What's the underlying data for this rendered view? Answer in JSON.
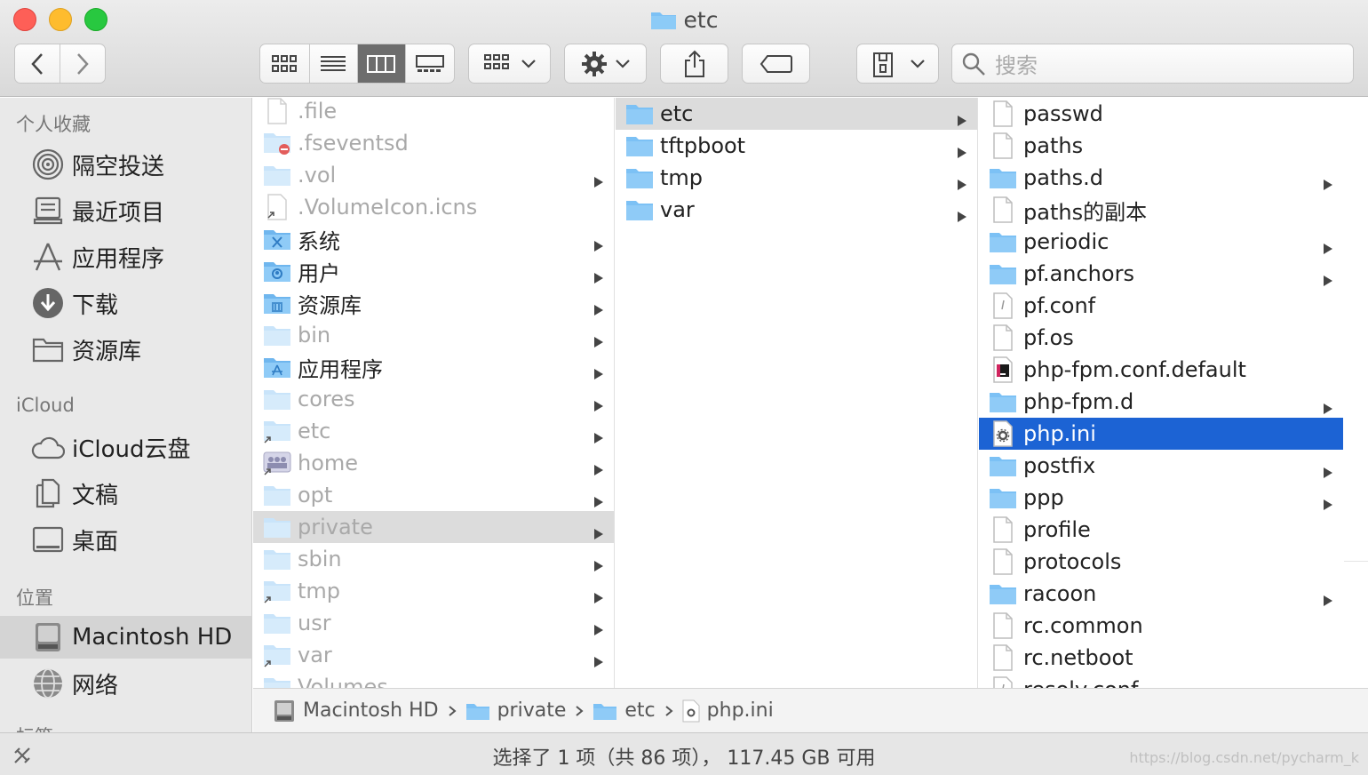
{
  "window": {
    "title": "etc"
  },
  "toolbar": {
    "search_placeholder": "搜索"
  },
  "sidebar": {
    "favorites_header": "个人收藏",
    "favorites": [
      {
        "label": "隔空投送",
        "icon": "airdrop-icon"
      },
      {
        "label": "最近项目",
        "icon": "recents-icon"
      },
      {
        "label": "应用程序",
        "icon": "applications-icon"
      },
      {
        "label": "下载",
        "icon": "downloads-icon"
      },
      {
        "label": "资源库",
        "icon": "folder-icon"
      }
    ],
    "icloud_header": "iCloud",
    "icloud": [
      {
        "label": "iCloud云盘",
        "icon": "cloud-icon"
      },
      {
        "label": "文稿",
        "icon": "documents-icon"
      },
      {
        "label": "桌面",
        "icon": "desktop-icon"
      }
    ],
    "locations_header": "位置",
    "locations": [
      {
        "label": "Macintosh HD",
        "icon": "hard-drive-icon"
      },
      {
        "label": "网络",
        "icon": "network-icon"
      }
    ],
    "tags_header": "标签"
  },
  "columns": {
    "col1": [
      {
        "name": ".file",
        "kind": "file",
        "dim": true,
        "chevron": false
      },
      {
        "name": ".fseventsd",
        "kind": "folder-restricted",
        "dim": true,
        "chevron": false
      },
      {
        "name": ".vol",
        "kind": "folder",
        "dim": true,
        "chevron": true
      },
      {
        "name": ".VolumeIcon.icns",
        "kind": "alias-file",
        "dim": true,
        "chevron": false
      },
      {
        "name": "系统",
        "kind": "folder-system",
        "dim": false,
        "chevron": true
      },
      {
        "name": "用户",
        "kind": "folder-users",
        "dim": false,
        "chevron": true
      },
      {
        "name": "资源库",
        "kind": "folder-library",
        "dim": false,
        "chevron": true
      },
      {
        "name": "bin",
        "kind": "folder",
        "dim": true,
        "chevron": true
      },
      {
        "name": "应用程序",
        "kind": "folder-apps",
        "dim": false,
        "chevron": true
      },
      {
        "name": "cores",
        "kind": "folder",
        "dim": true,
        "chevron": true
      },
      {
        "name": "etc",
        "kind": "alias-folder",
        "dim": true,
        "chevron": true
      },
      {
        "name": "home",
        "kind": "network-folder",
        "dim": true,
        "chevron": true
      },
      {
        "name": "opt",
        "kind": "folder",
        "dim": true,
        "chevron": true
      },
      {
        "name": "private",
        "kind": "folder",
        "dim": true,
        "chevron": true,
        "highlight": true
      },
      {
        "name": "sbin",
        "kind": "folder",
        "dim": true,
        "chevron": true
      },
      {
        "name": "tmp",
        "kind": "alias-folder",
        "dim": true,
        "chevron": true
      },
      {
        "name": "usr",
        "kind": "folder",
        "dim": true,
        "chevron": true
      },
      {
        "name": "var",
        "kind": "alias-folder",
        "dim": true,
        "chevron": true
      },
      {
        "name": "Volumes",
        "kind": "folder",
        "dim": true,
        "chevron": true
      }
    ],
    "col2": [
      {
        "name": "etc",
        "kind": "folder",
        "chevron": true,
        "highlight": true
      },
      {
        "name": "tftpboot",
        "kind": "folder",
        "chevron": true
      },
      {
        "name": "tmp",
        "kind": "folder",
        "chevron": true
      },
      {
        "name": "var",
        "kind": "folder",
        "chevron": true
      }
    ],
    "col3": [
      {
        "name": "passwd",
        "kind": "file",
        "chevron": false
      },
      {
        "name": "paths",
        "kind": "file",
        "chevron": false
      },
      {
        "name": "paths.d",
        "kind": "folder",
        "chevron": true
      },
      {
        "name": "paths的副本",
        "kind": "file",
        "chevron": false
      },
      {
        "name": "periodic",
        "kind": "folder",
        "chevron": true
      },
      {
        "name": "pf.anchors",
        "kind": "folder",
        "chevron": true
      },
      {
        "name": "pf.conf",
        "kind": "conf-file",
        "chevron": false
      },
      {
        "name": "pf.os",
        "kind": "file",
        "chevron": false
      },
      {
        "name": "php-fpm.conf.default",
        "kind": "ide-file",
        "chevron": false
      },
      {
        "name": "php-fpm.d",
        "kind": "folder",
        "chevron": true
      },
      {
        "name": "php.ini",
        "kind": "settings-file",
        "chevron": false,
        "selected": true
      },
      {
        "name": "postfix",
        "kind": "folder",
        "chevron": true
      },
      {
        "name": "ppp",
        "kind": "folder",
        "chevron": true
      },
      {
        "name": "profile",
        "kind": "file",
        "chevron": false
      },
      {
        "name": "protocols",
        "kind": "file",
        "chevron": false
      },
      {
        "name": "racoon",
        "kind": "folder",
        "chevron": true
      },
      {
        "name": "rc.common",
        "kind": "file",
        "chevron": false
      },
      {
        "name": "rc.netboot",
        "kind": "file",
        "chevron": false
      },
      {
        "name": "resolv.conf",
        "kind": "conf-file",
        "chevron": false
      }
    ]
  },
  "pathbar": [
    {
      "label": "Macintosh HD",
      "icon": "hard-drive-icon"
    },
    {
      "label": "private",
      "icon": "folder-icon"
    },
    {
      "label": "etc",
      "icon": "folder-icon"
    },
    {
      "label": "php.ini",
      "icon": "settings-file-icon"
    }
  ],
  "status": {
    "text": "选择了 1 项（共 86 项）， 117.45 GB 可用",
    "watermark": "https://blog.csdn.net/pycharm_k"
  },
  "colors": {
    "selection": "#1c63d4",
    "folder": "#7cc1f5",
    "sidebar_bg": "#e9e9e9"
  }
}
